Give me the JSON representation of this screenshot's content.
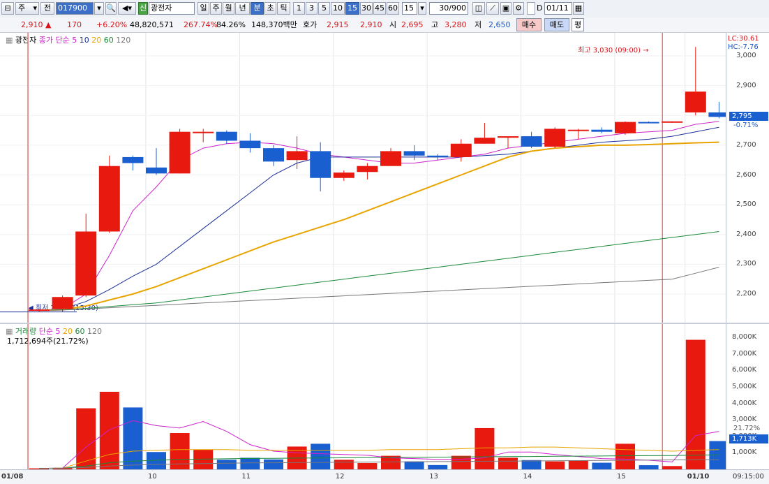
{
  "toolbar": {
    "market_type": "주",
    "prev_btn": "전",
    "code": "017900",
    "name_badge": "신",
    "stock_name": "광전자",
    "period_tabs": [
      "일",
      "주",
      "월",
      "년",
      "분",
      "초",
      "틱"
    ],
    "period_selected": "분",
    "minute_tabs": [
      "1",
      "3",
      "5",
      "10",
      "15",
      "30",
      "45",
      "60"
    ],
    "minute_selected": "15",
    "minute_select_value": "15",
    "count_value": "30",
    "count_total": "/900",
    "date_check_label": "D",
    "date_value": "01/11"
  },
  "quote": {
    "price": "2,910",
    "direction": "▲",
    "change": "170",
    "change_pct": "+6.20%",
    "volume": "48,820,571",
    "vol_ratio": "267.74%",
    "turnover": "84.26%",
    "amount": "148,370백만",
    "hoga_label": "호가",
    "ask": "2,915",
    "bid": "2,910",
    "open_label": "시",
    "open": "2,695",
    "high_label": "고",
    "high": "3,280",
    "low_label": "저",
    "low": "2,650",
    "buy_button": "매수",
    "sell_button": "매도",
    "eval_button": "평"
  },
  "price_pane": {
    "legend_name": "광전자",
    "legend_price": "종가 단순",
    "ma_periods": [
      "5",
      "10",
      "20",
      "60",
      "120"
    ],
    "ma_colors": [
      "#cc22cc",
      "#1a2f9a",
      "#e8a400",
      "#1a8a3a",
      "#777777"
    ],
    "lc_label": "LC:30.61",
    "hc_label": "HC:-7.76",
    "high_annotation": "최고 3,030 (09:00) →",
    "low_annotation": "최저 2,140 (15:30)",
    "current_badge": "2,795",
    "current_pct": "-0.71%"
  },
  "volume_pane": {
    "legend_name": "거래량",
    "legend_type": "단순",
    "ma_periods": [
      "5",
      "20",
      "60",
      "120"
    ],
    "ma_colors": [
      "#cc22cc",
      "#e8a400",
      "#1a8a3a",
      "#777777"
    ],
    "summary": "1,712,694주(21.72%)",
    "current_badge": "1,713K",
    "current_pct": "21.72%"
  },
  "chart_data": {
    "type": "candlestick",
    "interval": "15분",
    "up_color": "#e8190e",
    "down_color": "#1a5fd0",
    "price_ticks": [
      3000,
      2900,
      2800,
      2700,
      2600,
      2500,
      2400,
      2300,
      2200
    ],
    "price_tick_labels": [
      "3,000",
      "2,900",
      "2,800",
      "2,700",
      "2,600",
      "2,500",
      "2,400",
      "2,300",
      "2,200"
    ],
    "price_range": [
      2140,
      3050
    ],
    "volume_ticks": [
      8000,
      7000,
      6000,
      5000,
      4000,
      3000,
      2000,
      1000
    ],
    "volume_tick_labels": [
      "8,000K",
      "7,000K",
      "6,000K",
      "5,000K",
      "4,000K",
      "3,000K",
      "2,000K",
      "1,000K"
    ],
    "volume_range": [
      0,
      8400
    ],
    "x_labels": [
      "01/08",
      "10",
      "11",
      "12",
      "13",
      "14",
      "15",
      "01/10"
    ],
    "x_label_candle_index": [
      0,
      5,
      9,
      13,
      17,
      21,
      25,
      28
    ],
    "time_label": "09:15:00",
    "candles": [
      {
        "o": 2145,
        "h": 2150,
        "l": 2140,
        "c": 2148,
        "v": 60
      },
      {
        "o": 2150,
        "h": 2195,
        "l": 2140,
        "c": 2190,
        "v": 80
      },
      {
        "o": 2195,
        "h": 2470,
        "l": 2190,
        "c": 2410,
        "v": 3700
      },
      {
        "o": 2410,
        "h": 2665,
        "l": 2405,
        "c": 2630,
        "v": 4700
      },
      {
        "o": 2660,
        "h": 2665,
        "l": 2615,
        "c": 2640,
        "v": 3750
      },
      {
        "o": 2625,
        "h": 2690,
        "l": 2600,
        "c": 2605,
        "v": 1050
      },
      {
        "o": 2605,
        "h": 2755,
        "l": 2605,
        "c": 2745,
        "v": 2200
      },
      {
        "o": 2745,
        "h": 2755,
        "l": 2710,
        "c": 2745,
        "v": 1200
      },
      {
        "o": 2745,
        "h": 2750,
        "l": 2705,
        "c": 2715,
        "v": 580
      },
      {
        "o": 2715,
        "h": 2740,
        "l": 2675,
        "c": 2690,
        "v": 700
      },
      {
        "o": 2690,
        "h": 2700,
        "l": 2630,
        "c": 2645,
        "v": 600
      },
      {
        "o": 2650,
        "h": 2730,
        "l": 2620,
        "c": 2680,
        "v": 1380
      },
      {
        "o": 2680,
        "h": 2710,
        "l": 2545,
        "c": 2590,
        "v": 1550
      },
      {
        "o": 2590,
        "h": 2615,
        "l": 2580,
        "c": 2608,
        "v": 580
      },
      {
        "o": 2610,
        "h": 2640,
        "l": 2585,
        "c": 2630,
        "v": 380
      },
      {
        "o": 2630,
        "h": 2690,
        "l": 2630,
        "c": 2680,
        "v": 820
      },
      {
        "o": 2680,
        "h": 2700,
        "l": 2650,
        "c": 2665,
        "v": 480
      },
      {
        "o": 2665,
        "h": 2670,
        "l": 2650,
        "c": 2660,
        "v": 260
      },
      {
        "o": 2660,
        "h": 2720,
        "l": 2645,
        "c": 2705,
        "v": 820
      },
      {
        "o": 2705,
        "h": 2775,
        "l": 2705,
        "c": 2725,
        "v": 2500
      },
      {
        "o": 2725,
        "h": 2730,
        "l": 2690,
        "c": 2730,
        "v": 700
      },
      {
        "o": 2730,
        "h": 2745,
        "l": 2690,
        "c": 2695,
        "v": 560
      },
      {
        "o": 2695,
        "h": 2760,
        "l": 2690,
        "c": 2755,
        "v": 480
      },
      {
        "o": 2750,
        "h": 2755,
        "l": 2720,
        "c": 2752,
        "v": 540
      },
      {
        "o": 2752,
        "h": 2760,
        "l": 2740,
        "c": 2745,
        "v": 400
      },
      {
        "o": 2740,
        "h": 2780,
        "l": 2735,
        "c": 2778,
        "v": 1550
      },
      {
        "o": 2778,
        "h": 2780,
        "l": 2775,
        "c": 2775,
        "v": 250
      },
      {
        "o": 2778,
        "h": 2780,
        "l": 2775,
        "c": 2780,
        "v": 200
      },
      {
        "o": 2810,
        "h": 3030,
        "l": 2800,
        "c": 2880,
        "v": 7850
      },
      {
        "o": 2810,
        "h": 2845,
        "l": 2790,
        "c": 2795,
        "v": 1713
      }
    ],
    "ma_price": [
      {
        "name": "5",
        "values": [
          2145,
          2150,
          2200,
          2330,
          2480,
          2560,
          2650,
          2690,
          2705,
          2710,
          2705,
          2690,
          2670,
          2660,
          2650,
          2640,
          2640,
          2650,
          2660,
          2670,
          2690,
          2700,
          2710,
          2720,
          2730,
          2740,
          2745,
          2750,
          2770,
          2780
        ]
      },
      {
        "name": "10",
        "values": [
          2145,
          2150,
          2175,
          2215,
          2260,
          2300,
          2360,
          2420,
          2480,
          2540,
          2600,
          2640,
          2660,
          2660,
          2660,
          2660,
          2660,
          2660,
          2660,
          2665,
          2670,
          2680,
          2690,
          2700,
          2710,
          2715,
          2720,
          2730,
          2745,
          2760
        ]
      },
      {
        "name": "20",
        "values": [
          2145,
          2147,
          2160,
          2180,
          2200,
          2225,
          2255,
          2285,
          2315,
          2345,
          2375,
          2400,
          2425,
          2450,
          2480,
          2510,
          2540,
          2570,
          2600,
          2630,
          2660,
          2680,
          2690,
          2695,
          2700,
          2700,
          2702,
          2705,
          2708,
          2710
        ]
      },
      {
        "name": "60",
        "values": [
          2145,
          2147,
          2152,
          2158,
          2164,
          2170,
          2180,
          2190,
          2200,
          2210,
          2220,
          2230,
          2240,
          2250,
          2260,
          2270,
          2280,
          2290,
          2300,
          2310,
          2320,
          2330,
          2340,
          2350,
          2360,
          2370,
          2380,
          2390,
          2400,
          2410
        ]
      },
      {
        "name": "120",
        "values": [
          2145,
          2146,
          2150,
          2154,
          2158,
          2162,
          2166,
          2170,
          2174,
          2178,
          2182,
          2186,
          2190,
          2194,
          2198,
          2202,
          2206,
          2210,
          2214,
          2218,
          2222,
          2226,
          2230,
          2234,
          2238,
          2242,
          2246,
          2250,
          2270,
          2290
        ]
      }
    ],
    "ma_volume": [
      {
        "name": "5",
        "values": [
          60,
          70,
          1350,
          2400,
          2950,
          2650,
          2500,
          2900,
          2300,
          1500,
          1100,
          1000,
          950,
          900,
          850,
          700,
          650,
          600,
          600,
          700,
          1050,
          1050,
          900,
          780,
          650,
          620,
          550,
          450,
          2050,
          2300
        ]
      },
      {
        "name": "20",
        "values": [
          60,
          70,
          500,
          900,
          1100,
          1150,
          1200,
          1200,
          1200,
          1150,
          1150,
          1150,
          1150,
          1150,
          1150,
          1200,
          1200,
          1200,
          1250,
          1300,
          1300,
          1350,
          1350,
          1300,
          1250,
          1200,
          1150,
          1100,
          1150,
          1200
        ]
      },
      {
        "name": "60",
        "values": [
          60,
          70,
          200,
          400,
          500,
          550,
          600,
          620,
          640,
          660,
          670,
          680,
          690,
          700,
          710,
          720,
          730,
          740,
          750,
          760,
          770,
          780,
          790,
          800,
          810,
          820,
          830,
          840,
          860,
          880
        ]
      },
      {
        "name": "120",
        "values": [
          60,
          70,
          120,
          200,
          260,
          300,
          330,
          350,
          370,
          390,
          400,
          410,
          420,
          430,
          440,
          450,
          460,
          470,
          480,
          490,
          500,
          510,
          520,
          530,
          540,
          550,
          560,
          570,
          580,
          590
        ]
      }
    ]
  }
}
